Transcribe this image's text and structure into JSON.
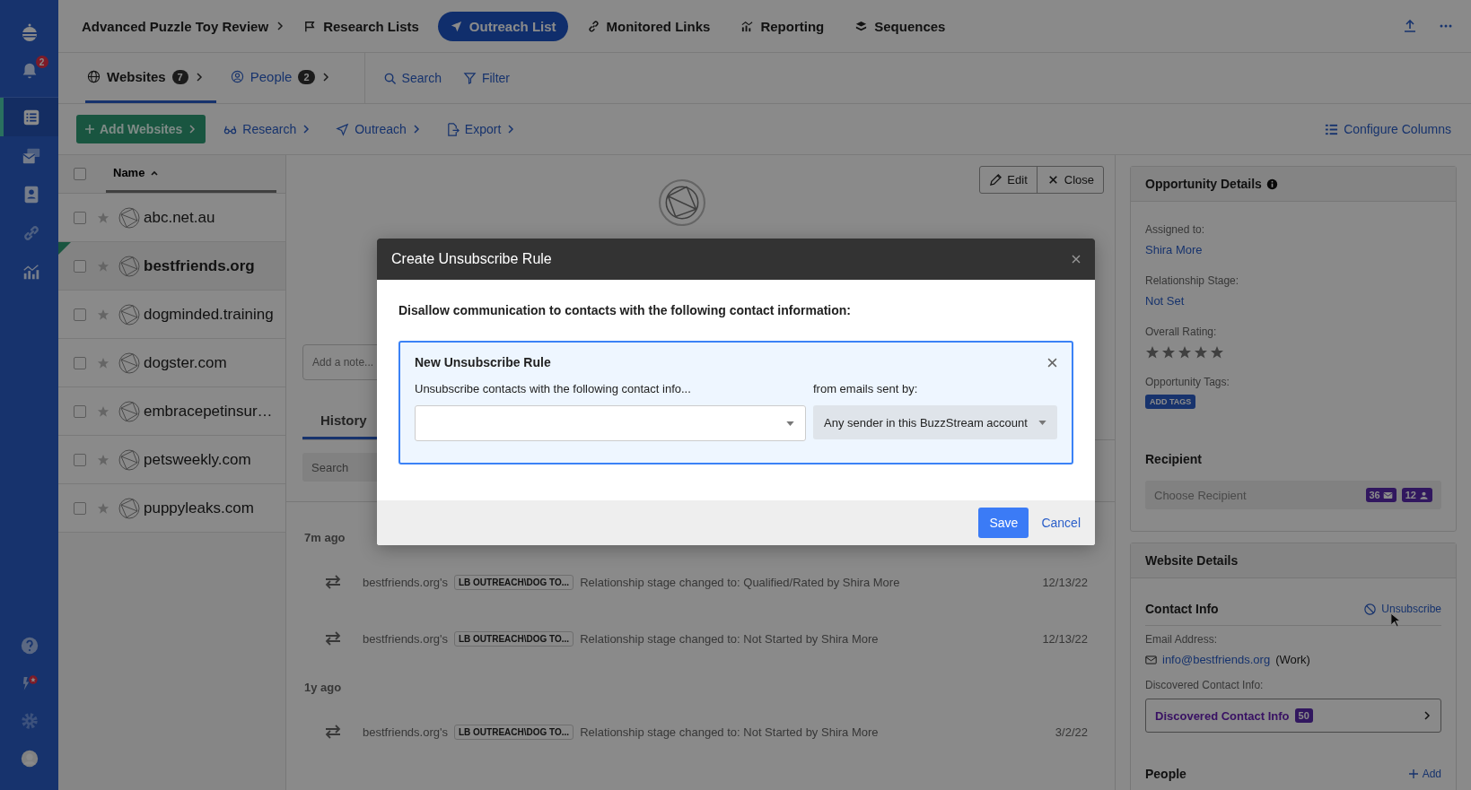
{
  "sidebar": {
    "notification_badge": "2",
    "items": [
      {
        "selected": true
      },
      {
        "selected": false
      },
      {
        "selected": false
      },
      {
        "selected": false
      },
      {
        "selected": false
      }
    ]
  },
  "breadcrumb": "Advanced Puzzle Toy Review",
  "nav": [
    {
      "label": "Research Lists",
      "selected": false
    },
    {
      "label": "Outreach List",
      "selected": true
    },
    {
      "label": "Monitored Links",
      "selected": false
    },
    {
      "label": "Reporting",
      "selected": false
    },
    {
      "label": "Sequences",
      "selected": false
    }
  ],
  "subtabs": [
    {
      "label": "Websites",
      "count": "7",
      "selected": true
    },
    {
      "label": "People",
      "count": "2",
      "selected": false
    }
  ],
  "subtab_actions": [
    "Search",
    "Filter"
  ],
  "toolbar": {
    "add": "Add Websites",
    "menus": [
      "Research",
      "Outreach",
      "Export"
    ],
    "configure": "Configure Columns"
  },
  "list": {
    "column": "Name",
    "all_checked": false,
    "rows": [
      {
        "name": "abc.net.au",
        "selected": false,
        "checked": false,
        "starred": false
      },
      {
        "name": "bestfriends.org",
        "selected": true,
        "checked": false,
        "starred": false
      },
      {
        "name": "dogminded.training",
        "selected": false,
        "checked": false,
        "starred": false
      },
      {
        "name": "dogster.com",
        "selected": false,
        "checked": false,
        "starred": false
      },
      {
        "name": "embracepetinsur…",
        "selected": false,
        "checked": false,
        "starred": false
      },
      {
        "name": "petsweekly.com",
        "selected": false,
        "checked": false,
        "starred": false
      },
      {
        "name": "puppyleaks.com",
        "selected": false,
        "checked": false,
        "starred": false
      }
    ]
  },
  "detail": {
    "buttons": [
      "Edit",
      "Close"
    ],
    "note_placeholder": "Add a note...",
    "tabs": [
      {
        "label": "History",
        "selected": true
      }
    ],
    "search_placeholder": "Search",
    "groups": [
      {
        "label": "7m ago",
        "entries": [
          {
            "site": "bestfriends.org's",
            "tag": "LB OUTREACH\\DOG TO...",
            "text": "Relationship stage changed to: Qualified/Rated by Shira More",
            "date": "12/13/22"
          },
          {
            "site": "bestfriends.org's",
            "tag": "LB OUTREACH\\DOG TO...",
            "text": "Relationship stage changed to: Not Started by Shira More",
            "date": "12/13/22"
          }
        ]
      },
      {
        "label": "1y ago",
        "entries": [
          {
            "site": "bestfriends.org's",
            "tag": "LB OUTREACH\\DOG TO...",
            "text": "Relationship stage changed to: Not Started by Shira More",
            "date": "3/2/22"
          }
        ]
      }
    ]
  },
  "opportunity": {
    "title": "Opportunity Details",
    "fields": [
      {
        "label": "Assigned to:",
        "value": "Shira More"
      },
      {
        "label": "Relationship Stage:",
        "value": "Not Set"
      }
    ],
    "rating_label": "Overall Rating:",
    "stars": 0,
    "tags_label": "Opportunity Tags:",
    "tags_button": "ADD TAGS",
    "recipient_title": "Recipient",
    "recipient_placeholder": "Choose Recipient",
    "recipient_badges": [
      "36",
      "12"
    ]
  },
  "website": {
    "title": "Website Details",
    "contact_title": "Contact Info",
    "unsubscribe": "Unsubscribe",
    "email_label": "Email Address:",
    "email": "info@bestfriends.org",
    "email_type": "(Work)",
    "discovered_label": "Discovered Contact Info:",
    "discovered_button": "Discovered Contact Info",
    "discovered_count": "50",
    "people_title": "People",
    "add": "Add"
  },
  "modal": {
    "title": "Create Unsubscribe Rule",
    "prompt": "Disallow communication to contacts with the following contact information:",
    "rule_title": "New Unsubscribe Rule",
    "info_label": "Unsubscribe contacts with the following contact info...",
    "sender_label": "from emails sent by:",
    "sender_value": "Any sender in this BuzzStream account",
    "save": "Save",
    "cancel": "Cancel"
  }
}
